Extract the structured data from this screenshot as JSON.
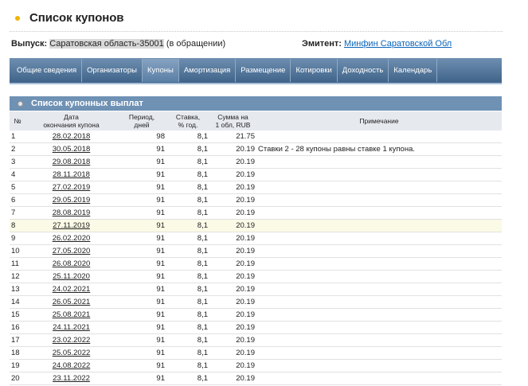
{
  "page": {
    "title": "Список купонов"
  },
  "info": {
    "issue_label": "Выпуск:",
    "issue_name": "Саратовская область-35001",
    "issue_status": "(в обращении)",
    "issuer_label": "Эмитент:",
    "issuer_name": "Минфин Саратовской Обл"
  },
  "tabs": [
    {
      "label": "Общие сведения"
    },
    {
      "label": "Организаторы"
    },
    {
      "label": "Купоны",
      "active": true
    },
    {
      "label": "Амортизация"
    },
    {
      "label": "Размещение"
    },
    {
      "label": "Котировки"
    },
    {
      "label": "Доходность"
    },
    {
      "label": "Календарь"
    }
  ],
  "section": {
    "title": "Список купонных выплат"
  },
  "table": {
    "headers": {
      "num": "№",
      "date_l1": "Дата",
      "date_l2": "окончания купона",
      "period_l1": "Период,",
      "period_l2": "дней",
      "rate_l1": "Ставка,",
      "rate_l2": "% год.",
      "sum_l1": "Сумма на",
      "sum_l2": "1 обл, RUB",
      "note": "Примечание"
    },
    "rows": [
      {
        "num": "1",
        "date": "28.02.2018",
        "period": "98",
        "rate": "8,1",
        "sum": "21.75",
        "note": ""
      },
      {
        "num": "2",
        "date": "30.05.2018",
        "period": "91",
        "rate": "8,1",
        "sum": "20.19",
        "note": "Ставки 2 - 28 купоны равны ставке 1 купона."
      },
      {
        "num": "3",
        "date": "29.08.2018",
        "period": "91",
        "rate": "8,1",
        "sum": "20.19",
        "note": ""
      },
      {
        "num": "4",
        "date": "28.11.2018",
        "period": "91",
        "rate": "8,1",
        "sum": "20.19",
        "note": ""
      },
      {
        "num": "5",
        "date": "27.02.2019",
        "period": "91",
        "rate": "8,1",
        "sum": "20.19",
        "note": ""
      },
      {
        "num": "6",
        "date": "29.05.2019",
        "period": "91",
        "rate": "8,1",
        "sum": "20.19",
        "note": ""
      },
      {
        "num": "7",
        "date": "28.08.2019",
        "period": "91",
        "rate": "8,1",
        "sum": "20.19",
        "note": ""
      },
      {
        "num": "8",
        "date": "27.11.2019",
        "period": "91",
        "rate": "8,1",
        "sum": "20.19",
        "note": ""
      },
      {
        "num": "9",
        "date": "26.02.2020",
        "period": "91",
        "rate": "8,1",
        "sum": "20.19",
        "note": ""
      },
      {
        "num": "10",
        "date": "27.05.2020",
        "period": "91",
        "rate": "8,1",
        "sum": "20.19",
        "note": ""
      },
      {
        "num": "11",
        "date": "26.08.2020",
        "period": "91",
        "rate": "8,1",
        "sum": "20.19",
        "note": ""
      },
      {
        "num": "12",
        "date": "25.11.2020",
        "period": "91",
        "rate": "8,1",
        "sum": "20.19",
        "note": ""
      },
      {
        "num": "13",
        "date": "24.02.2021",
        "period": "91",
        "rate": "8,1",
        "sum": "20.19",
        "note": ""
      },
      {
        "num": "14",
        "date": "26.05.2021",
        "period": "91",
        "rate": "8,1",
        "sum": "20.19",
        "note": ""
      },
      {
        "num": "15",
        "date": "25.08.2021",
        "period": "91",
        "rate": "8,1",
        "sum": "20.19",
        "note": ""
      },
      {
        "num": "16",
        "date": "24.11.2021",
        "period": "91",
        "rate": "8,1",
        "sum": "20.19",
        "note": ""
      },
      {
        "num": "17",
        "date": "23.02.2022",
        "period": "91",
        "rate": "8,1",
        "sum": "20.19",
        "note": ""
      },
      {
        "num": "18",
        "date": "25.05.2022",
        "period": "91",
        "rate": "8,1",
        "sum": "20.19",
        "note": ""
      },
      {
        "num": "19",
        "date": "24.08.2022",
        "period": "91",
        "rate": "8,1",
        "sum": "20.19",
        "note": ""
      },
      {
        "num": "20",
        "date": "23.11.2022",
        "period": "91",
        "rate": "8,1",
        "sum": "20.19",
        "note": ""
      }
    ],
    "highlighted_row": "8"
  },
  "colors": {
    "tab_bar": "#4a6d93",
    "section_header": "#6f91b4",
    "link": "#0a63b8",
    "bullet": "#f0b400",
    "row_highlight": "#fafae6"
  },
  "icons": {
    "title_bullet": "bullet-icon",
    "section_bullet": "section-bullet-icon"
  }
}
